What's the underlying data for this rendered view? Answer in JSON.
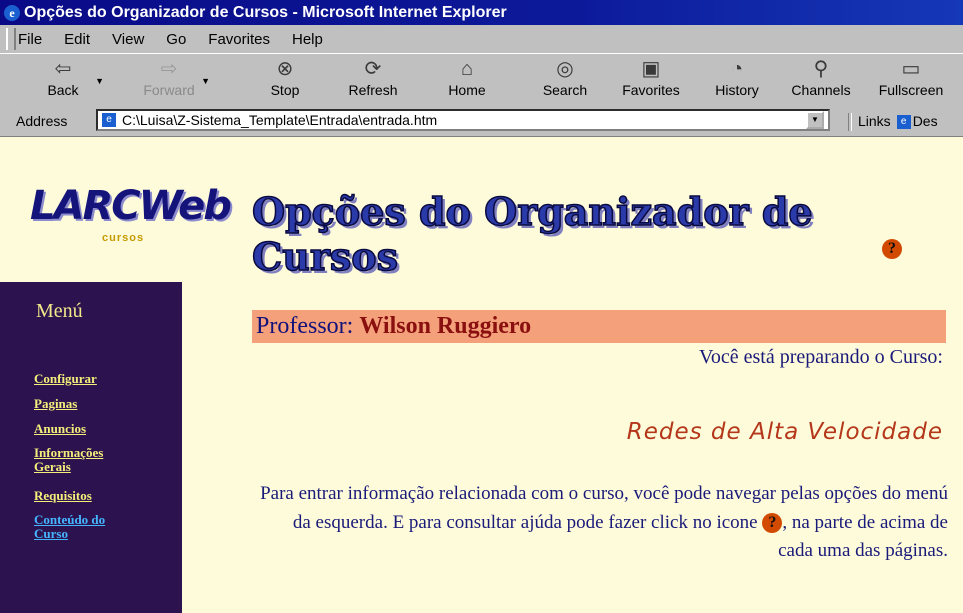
{
  "window": {
    "title": "Opções do Organizador de Cursos - Microsoft Internet Explorer",
    "icon": "ie-icon"
  },
  "menubar": {
    "items": [
      "File",
      "Edit",
      "View",
      "Go",
      "Favorites",
      "Help"
    ]
  },
  "toolbar": {
    "buttons": [
      {
        "label": "Back",
        "icon": "back-arrow-icon",
        "enabled": true
      },
      {
        "label": "Forward",
        "icon": "forward-arrow-icon",
        "enabled": false
      },
      {
        "label": "Stop",
        "icon": "stop-icon",
        "enabled": true
      },
      {
        "label": "Refresh",
        "icon": "refresh-icon",
        "enabled": true
      },
      {
        "label": "Home",
        "icon": "home-icon",
        "enabled": true
      },
      {
        "label": "Search",
        "icon": "search-icon",
        "enabled": true
      },
      {
        "label": "Favorites",
        "icon": "favorites-icon",
        "enabled": true
      },
      {
        "label": "History",
        "icon": "history-icon",
        "enabled": true
      },
      {
        "label": "Channels",
        "icon": "channels-icon",
        "enabled": true
      },
      {
        "label": "Fullscreen",
        "icon": "fullscreen-icon",
        "enabled": true
      }
    ]
  },
  "address": {
    "label": "Address",
    "value": "C:\\Luisa\\Z-Sistema_Template\\Entrada\\entrada.htm",
    "links_label": "Links",
    "links_item": "Des"
  },
  "page": {
    "logo_text": "LARCWeb",
    "logo_subtext": "cursos",
    "heading": "Opções do Organizador de Cursos",
    "menu_title": "Menú",
    "menu_items": [
      {
        "label": "Configurar",
        "active": false
      },
      {
        "label": "Paginas",
        "active": false
      },
      {
        "label": "Anuncios",
        "active": false
      },
      {
        "label": "Informações Gerais",
        "active": false
      },
      {
        "label": "Requisitos",
        "active": false
      },
      {
        "label": "Conteúdo do Curso",
        "active": true
      }
    ],
    "professor_label": "Professor:",
    "professor_name": "Wilson Ruggiero",
    "preparing_text": "Você está preparando o Curso:",
    "course_name": "Redes de Alta Velocidade",
    "instruction_part1": "Para entrar informação relacionada com o curso, você pode navegar pelas opções do menú da esquerda. E para consultar ajúda pode fazer click no icone",
    "instruction_part2": ", na parte de acima de cada uma das páginas."
  },
  "colors": {
    "sidebar_bg": "#2c124f",
    "content_bg": "#fdfbd9",
    "professor_bar": "#f4a07a",
    "course_text": "#b5371b",
    "active_link": "#46b5ff"
  }
}
